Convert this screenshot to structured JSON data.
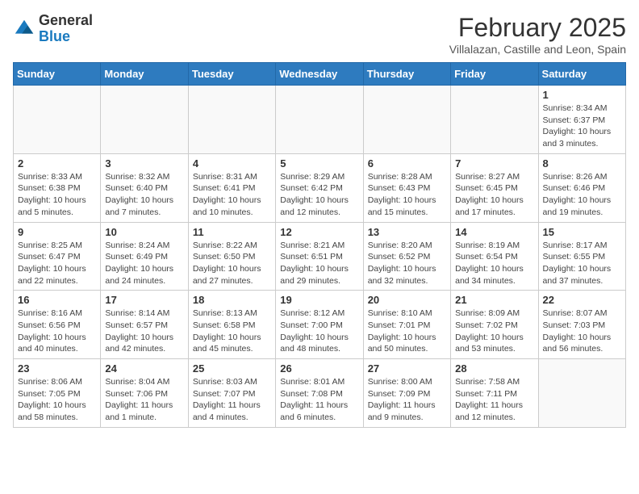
{
  "header": {
    "logo_general": "General",
    "logo_blue": "Blue",
    "month_year": "February 2025",
    "location": "Villalazan, Castille and Leon, Spain"
  },
  "weekdays": [
    "Sunday",
    "Monday",
    "Tuesday",
    "Wednesday",
    "Thursday",
    "Friday",
    "Saturday"
  ],
  "weeks": [
    [
      {
        "day": "",
        "info": ""
      },
      {
        "day": "",
        "info": ""
      },
      {
        "day": "",
        "info": ""
      },
      {
        "day": "",
        "info": ""
      },
      {
        "day": "",
        "info": ""
      },
      {
        "day": "",
        "info": ""
      },
      {
        "day": "1",
        "info": "Sunrise: 8:34 AM\nSunset: 6:37 PM\nDaylight: 10 hours and 3 minutes."
      }
    ],
    [
      {
        "day": "2",
        "info": "Sunrise: 8:33 AM\nSunset: 6:38 PM\nDaylight: 10 hours and 5 minutes."
      },
      {
        "day": "3",
        "info": "Sunrise: 8:32 AM\nSunset: 6:40 PM\nDaylight: 10 hours and 7 minutes."
      },
      {
        "day": "4",
        "info": "Sunrise: 8:31 AM\nSunset: 6:41 PM\nDaylight: 10 hours and 10 minutes."
      },
      {
        "day": "5",
        "info": "Sunrise: 8:29 AM\nSunset: 6:42 PM\nDaylight: 10 hours and 12 minutes."
      },
      {
        "day": "6",
        "info": "Sunrise: 8:28 AM\nSunset: 6:43 PM\nDaylight: 10 hours and 15 minutes."
      },
      {
        "day": "7",
        "info": "Sunrise: 8:27 AM\nSunset: 6:45 PM\nDaylight: 10 hours and 17 minutes."
      },
      {
        "day": "8",
        "info": "Sunrise: 8:26 AM\nSunset: 6:46 PM\nDaylight: 10 hours and 19 minutes."
      }
    ],
    [
      {
        "day": "9",
        "info": "Sunrise: 8:25 AM\nSunset: 6:47 PM\nDaylight: 10 hours and 22 minutes."
      },
      {
        "day": "10",
        "info": "Sunrise: 8:24 AM\nSunset: 6:49 PM\nDaylight: 10 hours and 24 minutes."
      },
      {
        "day": "11",
        "info": "Sunrise: 8:22 AM\nSunset: 6:50 PM\nDaylight: 10 hours and 27 minutes."
      },
      {
        "day": "12",
        "info": "Sunrise: 8:21 AM\nSunset: 6:51 PM\nDaylight: 10 hours and 29 minutes."
      },
      {
        "day": "13",
        "info": "Sunrise: 8:20 AM\nSunset: 6:52 PM\nDaylight: 10 hours and 32 minutes."
      },
      {
        "day": "14",
        "info": "Sunrise: 8:19 AM\nSunset: 6:54 PM\nDaylight: 10 hours and 34 minutes."
      },
      {
        "day": "15",
        "info": "Sunrise: 8:17 AM\nSunset: 6:55 PM\nDaylight: 10 hours and 37 minutes."
      }
    ],
    [
      {
        "day": "16",
        "info": "Sunrise: 8:16 AM\nSunset: 6:56 PM\nDaylight: 10 hours and 40 minutes."
      },
      {
        "day": "17",
        "info": "Sunrise: 8:14 AM\nSunset: 6:57 PM\nDaylight: 10 hours and 42 minutes."
      },
      {
        "day": "18",
        "info": "Sunrise: 8:13 AM\nSunset: 6:58 PM\nDaylight: 10 hours and 45 minutes."
      },
      {
        "day": "19",
        "info": "Sunrise: 8:12 AM\nSunset: 7:00 PM\nDaylight: 10 hours and 48 minutes."
      },
      {
        "day": "20",
        "info": "Sunrise: 8:10 AM\nSunset: 7:01 PM\nDaylight: 10 hours and 50 minutes."
      },
      {
        "day": "21",
        "info": "Sunrise: 8:09 AM\nSunset: 7:02 PM\nDaylight: 10 hours and 53 minutes."
      },
      {
        "day": "22",
        "info": "Sunrise: 8:07 AM\nSunset: 7:03 PM\nDaylight: 10 hours and 56 minutes."
      }
    ],
    [
      {
        "day": "23",
        "info": "Sunrise: 8:06 AM\nSunset: 7:05 PM\nDaylight: 10 hours and 58 minutes."
      },
      {
        "day": "24",
        "info": "Sunrise: 8:04 AM\nSunset: 7:06 PM\nDaylight: 11 hours and 1 minute."
      },
      {
        "day": "25",
        "info": "Sunrise: 8:03 AM\nSunset: 7:07 PM\nDaylight: 11 hours and 4 minutes."
      },
      {
        "day": "26",
        "info": "Sunrise: 8:01 AM\nSunset: 7:08 PM\nDaylight: 11 hours and 6 minutes."
      },
      {
        "day": "27",
        "info": "Sunrise: 8:00 AM\nSunset: 7:09 PM\nDaylight: 11 hours and 9 minutes."
      },
      {
        "day": "28",
        "info": "Sunrise: 7:58 AM\nSunset: 7:11 PM\nDaylight: 11 hours and 12 minutes."
      },
      {
        "day": "",
        "info": ""
      }
    ]
  ]
}
